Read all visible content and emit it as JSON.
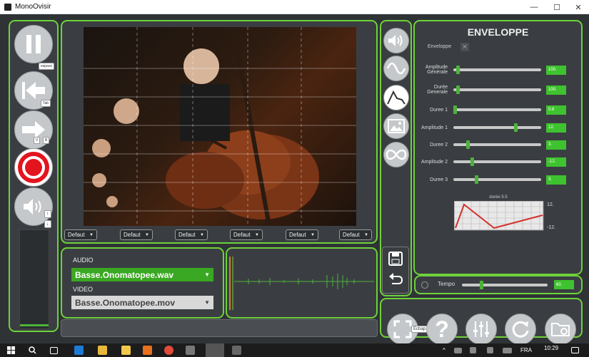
{
  "window": {
    "title": "MonoOvisir",
    "minimize": "—",
    "maximize": "☐",
    "close": "✕"
  },
  "left": {
    "pause_tip": "espace",
    "back_tip": "Tab",
    "fwd_tip_v": "V",
    "fwd_tip_b": "B",
    "vol_up": "↑",
    "vol_down": "↓"
  },
  "video": {
    "dropdowns": [
      "Defaut",
      "Defaut",
      "Defaut",
      "Defaut",
      "Defaut",
      "Defaut"
    ]
  },
  "media": {
    "audio_label": "AUDIO",
    "audio_value": "Basse.Onomatopee.wav",
    "video_label": "VIDEO",
    "video_value": "Basse.Onomatopee.mov"
  },
  "envelope": {
    "title": "ENVELOPPE",
    "enveloppe_label": "Enveloppe",
    "rows": [
      {
        "label": "Amplitude Générale",
        "value": "100.",
        "pos": 0.03
      },
      {
        "label": "Durée Generale",
        "value": "100.",
        "pos": 0.03
      },
      {
        "label": "Duree 1",
        "value": "0.8",
        "pos": 0.0
      },
      {
        "label": "Amplitude 1",
        "value": "12.",
        "pos": 0.72
      },
      {
        "label": "Duree 2",
        "value": "3.",
        "pos": 0.15
      },
      {
        "label": "Amplitude 2",
        "value": "-12.",
        "pos": 0.2
      },
      {
        "label": "Duree 3",
        "value": "3.",
        "pos": 0.25
      }
    ],
    "graph_title": "durée 5.5",
    "graph_max": "12.",
    "graph_min": "-12."
  },
  "tempo": {
    "label": "Tempo",
    "value": "60.",
    "pos": 0.22
  },
  "bottom": {
    "fullscreen_tip": "Echap"
  },
  "taskbar": {
    "time": "10:29",
    "lang": "FRA"
  },
  "colors": {
    "accent": "#6ed23a",
    "panel": "#3a3e42",
    "record": "#e3141e"
  }
}
